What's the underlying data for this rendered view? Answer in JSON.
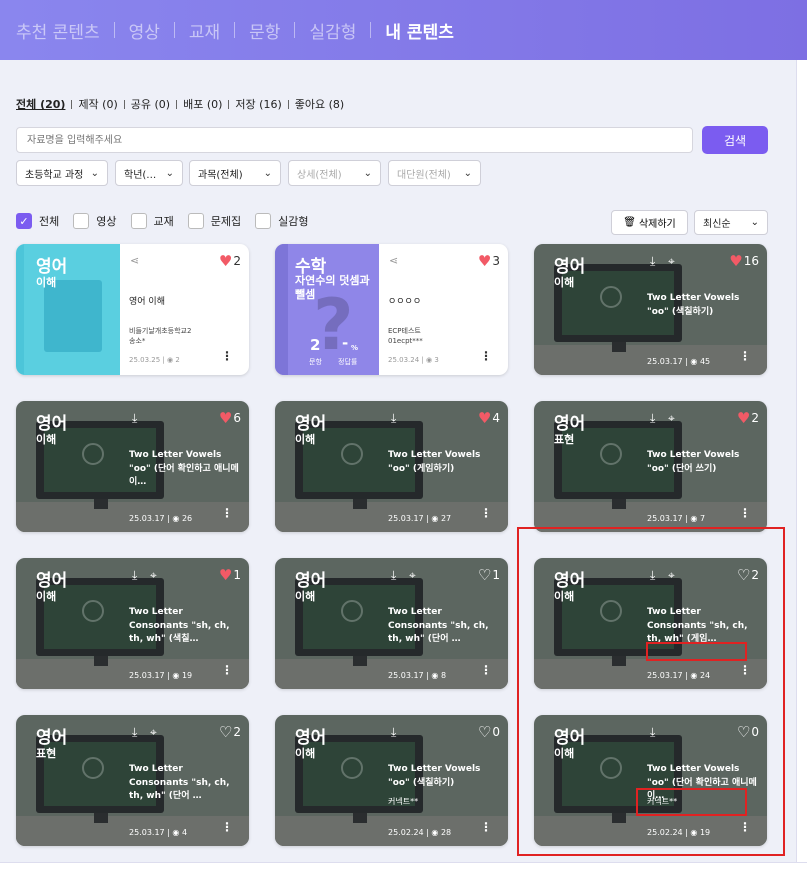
{
  "nav": {
    "tabs": [
      {
        "label": "추천 콘텐츠"
      },
      {
        "label": "영상"
      },
      {
        "label": "교재"
      },
      {
        "label": "문항"
      },
      {
        "label": "실감형"
      },
      {
        "label": "내 콘텐츠"
      }
    ],
    "active_tab": "내 콘텐츠"
  },
  "filters": [
    {
      "label": "전체 (20)"
    },
    {
      "label": "제작 (0)"
    },
    {
      "label": "공유 (0)"
    },
    {
      "label": "배포 (0)"
    },
    {
      "label": "저장 (16)"
    },
    {
      "label": "좋아요 (8)"
    }
  ],
  "search": {
    "placeholder": "자료명을 입력해주세요",
    "button": "검색"
  },
  "dropdowns": [
    {
      "label": "초등학교 과정"
    },
    {
      "label": "학년(…"
    },
    {
      "label": "과목(전체)"
    },
    {
      "label": "상세(전체)"
    },
    {
      "label": "대단원(전체)"
    }
  ],
  "types": [
    {
      "label": "전체",
      "checked": true
    },
    {
      "label": "영상",
      "checked": false
    },
    {
      "label": "교재",
      "checked": false
    },
    {
      "label": "문제집",
      "checked": false
    },
    {
      "label": "실감형",
      "checked": false
    }
  ],
  "actions": {
    "delete": "삭제하기",
    "sort": "최신순"
  },
  "cards": [
    {
      "subject": "영어",
      "sub": "이해",
      "title": "영어 이해",
      "author_line1": "비들기날개초등학교2",
      "author_line2": "송소*",
      "date": "25.03.25",
      "views": "2",
      "likes": "2",
      "liked": true
    },
    {
      "subject": "수학",
      "sub": "자연수의 덧셈과 뺄셈",
      "title": "ㅇㅇㅇㅇ",
      "author_line1": "ECP테스트",
      "author_line2": "01ecpt***",
      "date": "25.03.24",
      "views": "3",
      "likes": "3",
      "liked": true,
      "stat_num": "2",
      "stat_pct": "-",
      "stat_label1": "문항",
      "stat_label2": "정답률"
    },
    {
      "subject": "영어",
      "sub": "이해",
      "title": "Two Letter Vowels \"oo\" (색칠하기)",
      "author": "",
      "date": "25.03.17",
      "views": "45",
      "likes": "16",
      "liked": true
    },
    {
      "subject": "영어",
      "sub": "이해",
      "title": "Two Letter Vowels \"oo\" (단어 확인하고 애니메이…",
      "author": "",
      "date": "25.03.17",
      "views": "26",
      "likes": "6",
      "liked": true
    },
    {
      "subject": "영어",
      "sub": "이해",
      "title": "Two Letter Vowels \"oo\" (게임하기)",
      "author": "",
      "date": "25.03.17",
      "views": "27",
      "likes": "4",
      "liked": true
    },
    {
      "subject": "영어",
      "sub": "표현",
      "title": "Two Letter Vowels \"oo\" (단어 쓰기)",
      "author": "",
      "date": "25.03.17",
      "views": "7",
      "likes": "2",
      "liked": true
    },
    {
      "subject": "영어",
      "sub": "이해",
      "title": "Two Letter Consonants \"sh, ch, th, wh\" (색칠…",
      "author": "",
      "date": "25.03.17",
      "views": "19",
      "likes": "1",
      "liked": true
    },
    {
      "subject": "영어",
      "sub": "이해",
      "title": "Two Letter Consonants \"sh, ch, th, wh\" (단어 …",
      "author": "",
      "date": "25.03.17",
      "views": "8",
      "likes": "1",
      "liked": false
    },
    {
      "subject": "영어",
      "sub": "이해",
      "title": "Two Letter Consonants \"sh, ch, th, wh\" (게임…",
      "author": "",
      "date": "25.03.17",
      "views": "24",
      "likes": "2",
      "liked": false
    },
    {
      "subject": "영어",
      "sub": "표현",
      "title": "Two Letter Consonants \"sh, ch, th, wh\" (단어 …",
      "author": "",
      "date": "25.03.17",
      "views": "4",
      "likes": "2",
      "liked": false
    },
    {
      "subject": "영어",
      "sub": "이해",
      "title": "Two Letter Vowels \"oo\" (색칠하기)",
      "author": "커넥트**",
      "date": "25.02.24",
      "views": "28",
      "likes": "0",
      "liked": false
    },
    {
      "subject": "영어",
      "sub": "이해",
      "title": "Two Letter Vowels \"oo\" (단어 확인하고 애니메이…",
      "author": "커넥트**",
      "date": "25.02.24",
      "views": "19",
      "likes": "0",
      "liked": false
    }
  ],
  "colors": {
    "accent": "#7b5cf0",
    "heart": "#f25a66",
    "highlight": "#e02222",
    "english_panel": "#4cc5d9",
    "math_panel": "#8f86e8"
  }
}
